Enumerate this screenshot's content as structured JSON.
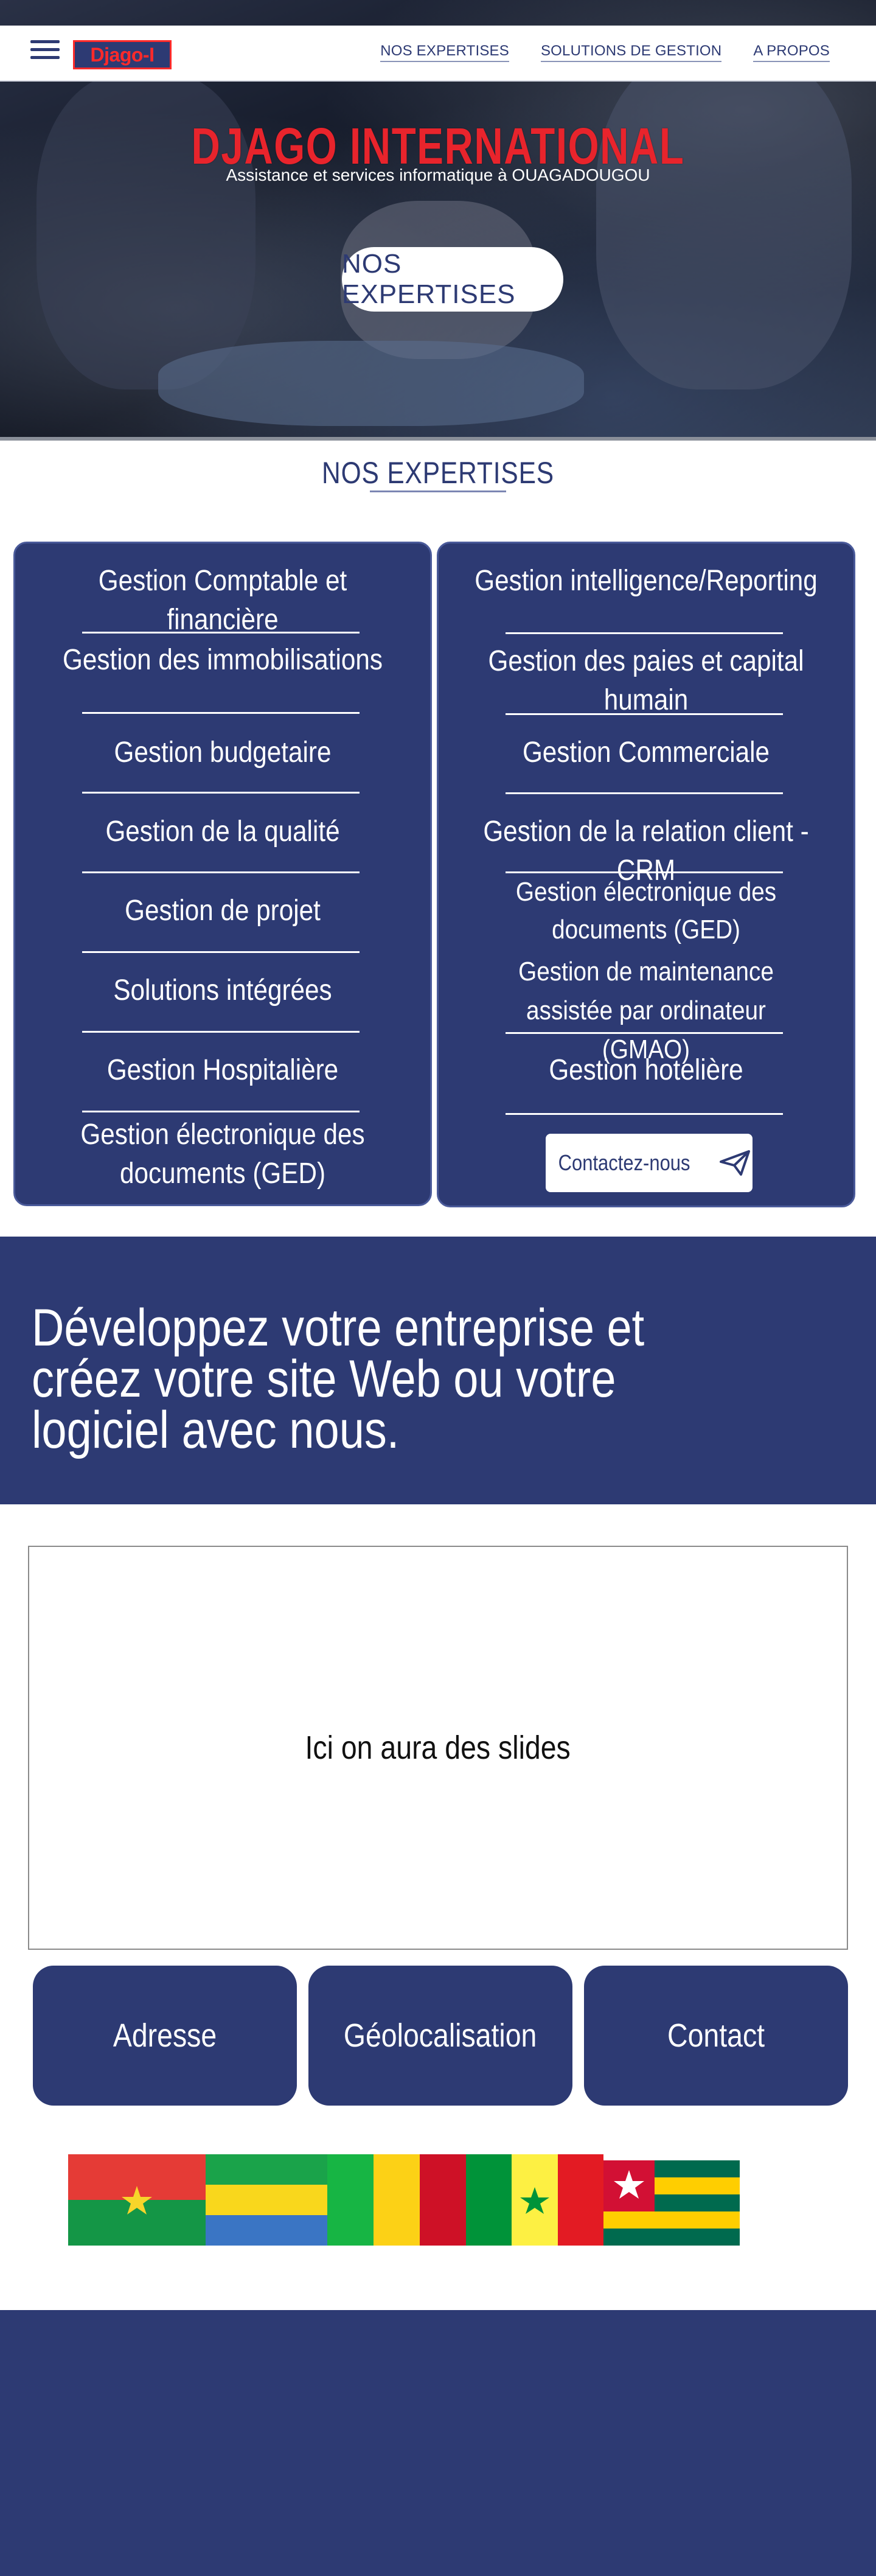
{
  "brand": {
    "logo_text": "Djago-I",
    "hero_title": "DJAGO  INTERNATIONAL",
    "hero_subtitle": "Assistance et services informatique à OUAGADOUGOU",
    "hero_button": "NOS EXPERTISES"
  },
  "nav": {
    "links": [
      "NOS EXPERTISES",
      "SOLUTIONS DE GESTION",
      "A PROPOS"
    ]
  },
  "expertises": {
    "title": "NOS EXPERTISES",
    "left_items": [
      "Gestion Comptable et financière",
      "Gestion des immobilisations",
      "Gestion budgetaire",
      "Gestion de la qualité",
      "Gestion de projet",
      "Solutions intégrées",
      "Gestion Hospitalière",
      "Gestion électronique des documents (GED)"
    ],
    "right_items": [
      "Gestion intelligence/Reporting",
      "Gestion des paies et capital humain",
      "Gestion Commerciale",
      "Gestion de la relation client -CRM",
      "Gestion électronique des documents (GED)",
      "Gestion de maintenance assistée par ordinateur (GMAO)",
      "Gestion hotelière"
    ],
    "contact_button": "Contactez-nous"
  },
  "banner": {
    "text": "Développez votre entreprise et créez votre site Web ou votre logiciel avec nous."
  },
  "slides": {
    "placeholder": "Ici on aura des slides"
  },
  "info_buttons": [
    "Adresse",
    "Géolocalisation",
    "Contact"
  ],
  "colors": {
    "primary": "#2d3a73",
    "accent_red": "#e8242c",
    "white": "#ffffff"
  },
  "icons": [
    "menu-icon",
    "send-icon"
  ],
  "flags": [
    "burkina-faso-flag",
    "gabon-flag",
    "mali-flag",
    "senegal-flag",
    "togo-flag"
  ]
}
